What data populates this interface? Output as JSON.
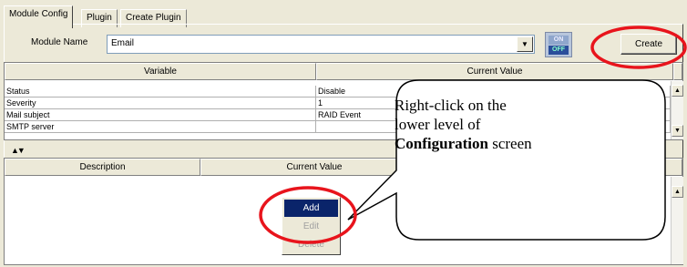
{
  "tabs": [
    "Module Config",
    "Plugin",
    "Create Plugin"
  ],
  "module": {
    "label": "Module Name",
    "value": "Email",
    "toggle_on": "ON",
    "toggle_off": "OFF",
    "create_label": "Create"
  },
  "upper_grid": {
    "columns": [
      "Variable",
      "Current Value"
    ],
    "rows": [
      [
        "Status",
        "Disable"
      ],
      [
        "Severity",
        "1"
      ],
      [
        "Mail subject",
        "RAID Event"
      ],
      [
        "SMTP server",
        ""
      ]
    ]
  },
  "lower_grid": {
    "columns": [
      "Description",
      "Current Value"
    ]
  },
  "context_menu": {
    "items": [
      "Add",
      "Edit",
      "Delete"
    ]
  },
  "callout": {
    "line1": "Right-click on the",
    "line2": "lower level of",
    "line3_bold": "Configuration",
    "line3_rest": " screen"
  },
  "colors": {
    "highlight_ring": "#e8141c",
    "menu_selection": "#0a246a"
  }
}
